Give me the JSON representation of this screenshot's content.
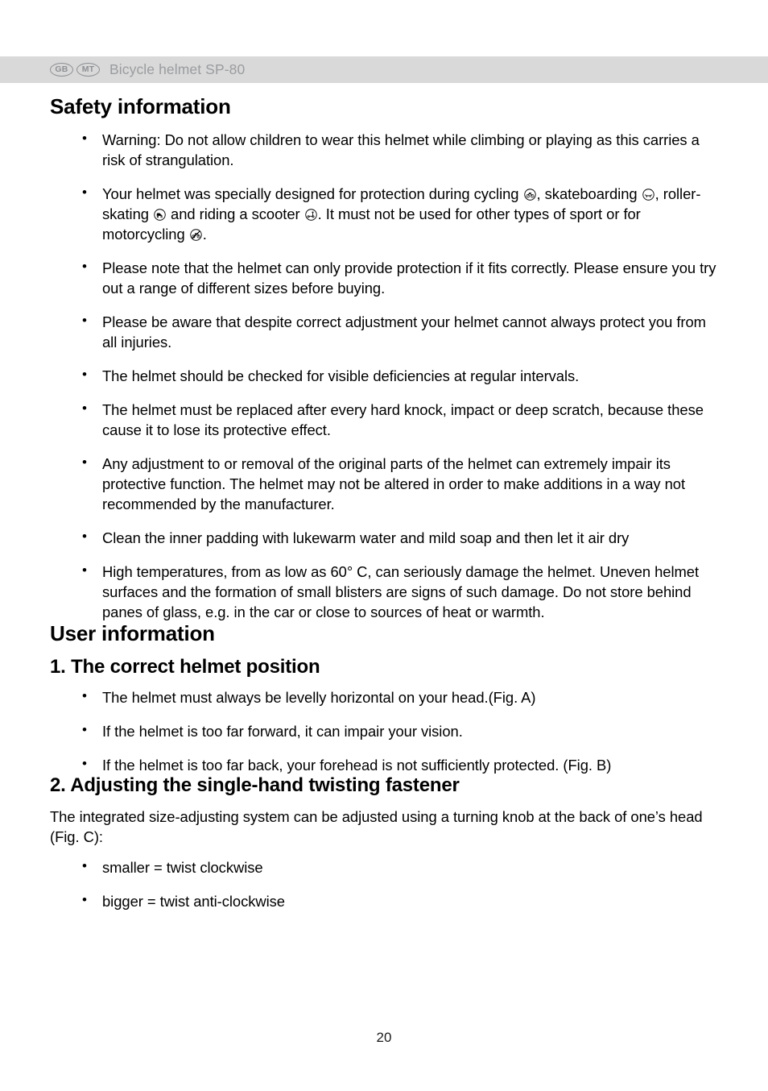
{
  "header": {
    "badges": [
      {
        "code": "GB",
        "name": "gb-badge"
      },
      {
        "code": "MT",
        "name": "mt-badge"
      }
    ],
    "title": "Bicycle helmet SP-80",
    "band_color": "#d9d9d9",
    "text_color": "#9a9c9f"
  },
  "safety": {
    "heading": "Safety information",
    "bullets": [
      {
        "text": "Warning: Do not allow children to wear this helmet while climbing or playing as this carries a risk of strangulation."
      },
      {
        "segments": [
          {
            "type": "text",
            "value": "Your helmet was specially designed for protection during cycling "
          },
          {
            "type": "icon",
            "value": "bicycle-icon"
          },
          {
            "type": "text",
            "value": ", skateboarding "
          },
          {
            "type": "icon",
            "value": "skateboard-icon"
          },
          {
            "type": "text",
            "value": ", roller-skating "
          },
          {
            "type": "icon",
            "value": "roller-skate-icon"
          },
          {
            "type": "text",
            "value": " and riding a scooter "
          },
          {
            "type": "icon",
            "value": "scooter-icon"
          },
          {
            "type": "text",
            "value": ". It must not be used for other types of sport or for motorcycling "
          },
          {
            "type": "icon",
            "value": "no-motorcycle-icon"
          },
          {
            "type": "text",
            "value": "."
          }
        ]
      },
      {
        "text": "Please note that the helmet can only provide protection if it fits correctly. Please ensure you try out a range of different sizes before buying."
      },
      {
        "text": "Please be aware that despite correct adjustment your helmet cannot always protect you from all injuries."
      },
      {
        "text": "The helmet should be checked for visible deficiencies at regular intervals."
      },
      {
        "text": "The helmet must be replaced after every hard knock, impact or deep scratch, because these cause it to lose its protective effect."
      },
      {
        "text": "Any adjustment to or removal of the original parts of the helmet can extremely impair its protective function. The helmet may not be altered in order to make additions in a way not recommended by the manufacturer."
      },
      {
        "text": "Clean the inner padding with lukewarm water and mild soap and then let it air dry"
      },
      {
        "text": "High temperatures, from as low as 60° C, can seriously damage the helmet. Uneven helmet surfaces and the formation of small blisters are signs of such damage. Do not store behind panes of glass, e.g. in the car or close to sources of heat or warmth."
      }
    ]
  },
  "user_information": {
    "heading": "User information",
    "section1": {
      "heading": "1. The correct helmet position",
      "bullets": [
        {
          "text": "The helmet must always be levelly horizontal on your head.(Fig. A)"
        },
        {
          "text": "If the helmet is too far forward, it can impair your vision."
        },
        {
          "text": "If the helmet is too far back, your forehead is not sufficiently protected. (Fig. B)"
        }
      ]
    },
    "section2": {
      "heading": "2. Adjusting the single-hand twisting fastener",
      "paragraph": "The integrated size-adjusting system can be adjusted using a turning knob at the back of one’s head (Fig. C):",
      "bullets": [
        {
          "text": "smaller = twist clockwise"
        },
        {
          "text": "bigger = twist anti-clockwise"
        }
      ]
    }
  },
  "footer": {
    "page_number": "20"
  }
}
